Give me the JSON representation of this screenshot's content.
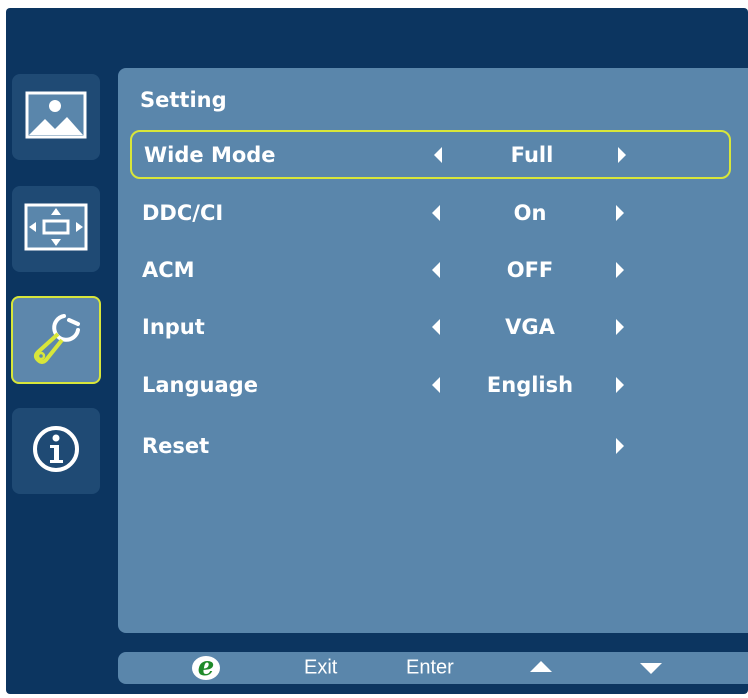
{
  "colors": {
    "frame": "#0c3560",
    "panel": "#5a86ab",
    "tile": "#1f4a74",
    "highlight": "#d8e63a",
    "text": "#ffffff"
  },
  "sidebar": {
    "items": [
      {
        "icon": "picture-icon",
        "active": false
      },
      {
        "icon": "position-icon",
        "active": false
      },
      {
        "icon": "wrench-icon",
        "active": true
      },
      {
        "icon": "info-icon",
        "active": false
      }
    ]
  },
  "panel": {
    "title": "Setting",
    "rows": [
      {
        "label": "Wide Mode",
        "value": "Full",
        "has_left": true,
        "selected": true
      },
      {
        "label": "DDC/CI",
        "value": "On",
        "has_left": true,
        "selected": false
      },
      {
        "label": "ACM",
        "value": "OFF",
        "has_left": true,
        "selected": false
      },
      {
        "label": "Input",
        "value": "VGA",
        "has_left": true,
        "selected": false
      },
      {
        "label": "Language",
        "value": "English",
        "has_left": true,
        "selected": false
      },
      {
        "label": "Reset",
        "value": "",
        "has_left": false,
        "selected": false
      }
    ]
  },
  "footer": {
    "e_label": "e",
    "exit_label": "Exit",
    "enter_label": "Enter",
    "up_icon": "triangle-up-icon",
    "down_icon": "triangle-down-icon"
  }
}
